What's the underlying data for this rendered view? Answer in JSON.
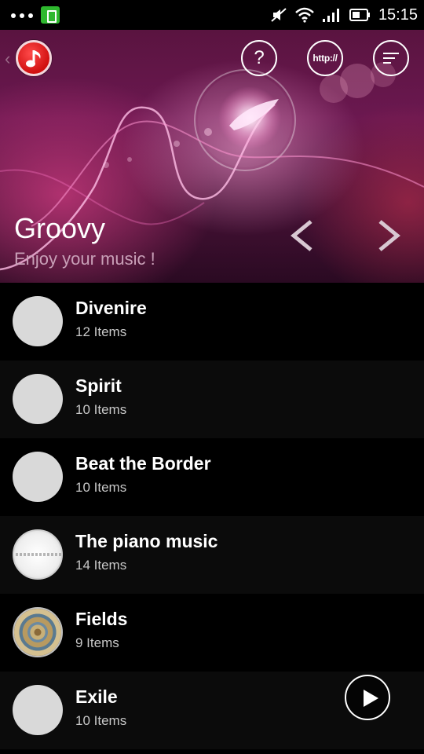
{
  "status_bar": {
    "time": "15:15",
    "icons": [
      "more-dots-icon",
      "battery-app-icon",
      "mute-icon",
      "wifi-icon",
      "signal-icon",
      "battery-icon"
    ]
  },
  "header": {
    "title": "Groovy",
    "subtitle": "Enjoy your music !",
    "help_label": "?",
    "web_label": "http://",
    "icons": [
      "back-chevron-icon",
      "music-note-icon",
      "help-icon",
      "web-icon",
      "sort-menu-icon",
      "prev-arrow-icon",
      "next-arrow-icon"
    ],
    "accent": "#e0207a"
  },
  "playlists": [
    {
      "title": "Divenire",
      "count": "12 Items"
    },
    {
      "title": "Spirit",
      "count": "10 Items"
    },
    {
      "title": "Beat the Border",
      "count": "10 Items"
    },
    {
      "title": "The piano music",
      "count": "14 Items"
    },
    {
      "title": "Fields",
      "count": "9 Items"
    },
    {
      "title": "Exile",
      "count": "10 Items"
    }
  ],
  "player": {
    "icon": "play-icon"
  }
}
